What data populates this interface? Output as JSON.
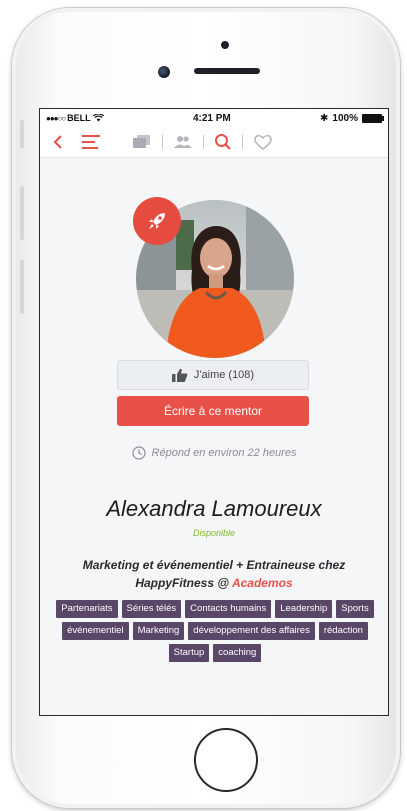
{
  "status_bar": {
    "carrier": "BELL",
    "time": "4:21 PM",
    "battery": "100%"
  },
  "nav": {
    "icons": [
      "back-arrow-icon",
      "menu-list-icon",
      "cards-icon",
      "users-icon",
      "search-icon",
      "heart-icon"
    ],
    "accent_color": "#e8514a"
  },
  "profile": {
    "badge_icon": "rocket-icon",
    "like_label": "J'aime (108)",
    "write_label": "Écrire à ce mentor",
    "response_text": "Répond en environ 22 heures",
    "name": "Alexandra Lamoureux",
    "availability": "Disponible",
    "bio_line1": "Marketing et événementiel + Entraineuse chez",
    "bio_line2_prefix": "HappyFitness @",
    "bio_org": "Academos"
  },
  "tags": [
    "Partenariats",
    "Séries télés",
    "Contacts humains",
    "Leadership",
    "Sports",
    "événementiel",
    "Marketing",
    "développement des affaires",
    "rédaction",
    "Startup",
    "coaching"
  ],
  "colors": {
    "primary": "#e8514a",
    "tag_bg": "#5a4768",
    "available": "#7dbb2c"
  }
}
